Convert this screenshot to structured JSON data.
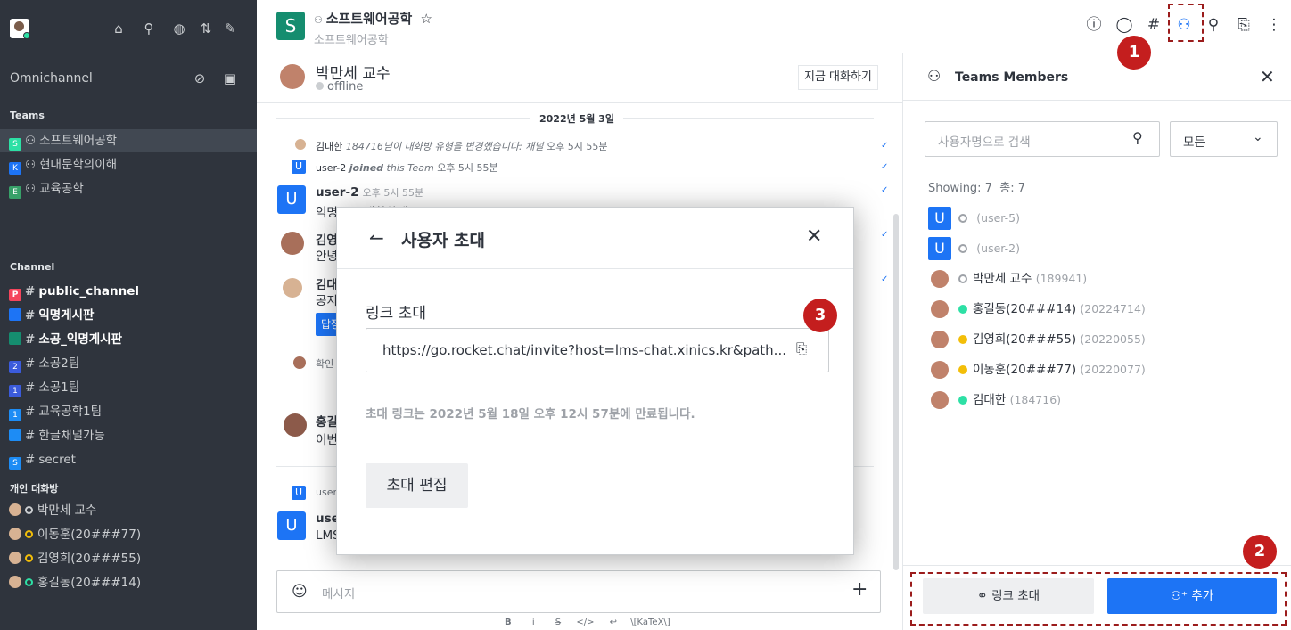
{
  "sidebar": {
    "workspace_label": "Omnichannel",
    "teams_heading": "Teams",
    "teams": [
      {
        "badge": "S",
        "color": "#2de0a5",
        "label": "소프트웨어공학",
        "selected": true
      },
      {
        "badge": "K",
        "color": "#1d74f5",
        "label": "현대문학의이해",
        "selected": false
      },
      {
        "badge": "E",
        "color": "#38a169",
        "label": "교육공학",
        "selected": false
      }
    ],
    "channel_heading": "Channel",
    "channels": [
      {
        "badge": "P",
        "color": "#f5455c",
        "label": "public_channel",
        "bold": true
      },
      {
        "badge": "",
        "color": "#1d74f5",
        "label": "익명게시판",
        "bold": true
      },
      {
        "badge": "",
        "color": "#158d6f",
        "label": "소공_익명게시판",
        "bold": true
      },
      {
        "badge": "2",
        "color": "#3b5bdb",
        "label": "소공2팀",
        "bold": false
      },
      {
        "badge": "1",
        "color": "#3b5bdb",
        "label": "소공1팀",
        "bold": false
      },
      {
        "badge": "1",
        "color": "#1d8cf5",
        "label": "교육공학1팀",
        "bold": false
      },
      {
        "badge": "",
        "color": "#1d8cf5",
        "label": "한글채널가능",
        "bold": false
      },
      {
        "badge": "S",
        "color": "#1d8cf5",
        "label": "secret",
        "bold": false
      }
    ],
    "dm_heading": "개인 대화방",
    "dms": [
      {
        "label": "박만세 교수",
        "status": "offline",
        "status_color": "#cbced1"
      },
      {
        "label": "이동훈(20###77)",
        "status": "away",
        "status_color": "#f3be08"
      },
      {
        "label": "김영희(20###55)",
        "status": "away",
        "status_color": "#f3be08"
      },
      {
        "label": "홍길동(20###14)",
        "status": "online",
        "status_color": "#2de0a5"
      }
    ]
  },
  "header": {
    "avatar_letter": "S",
    "title": "소프트웨어공학",
    "subtitle": "소프트웨어공학"
  },
  "chat": {
    "dm_name": "박만세 교수",
    "dm_status": "offline",
    "talk_now_button": "지금 대화하기",
    "date_divider": "2022년 5월 3일",
    "sys1_name": "김대한",
    "sys1_text": "184716님이 대화방 유형을 변경했습니다: 채널",
    "sys1_time": "오후 5시 55분",
    "sys2_name": "user-2",
    "sys2_joined": "joined",
    "sys2_text": "this Team",
    "sys2_time": "오후 5시 55분",
    "m1_name": "user-2",
    "m1_time": "오후 5시 55분",
    "m1_text": "익명으로 대화하세요",
    "m2_name": "김영희",
    "m2_text": "안녕",
    "m3_name": "김대한",
    "m3_text": "공지",
    "m3_btn": "답장",
    "m4_text": "확인",
    "m5_name": "홍길동",
    "m5_text": "이번",
    "m6_text": "user",
    "m7_name": "user",
    "m7_text": "LMS",
    "composer_placeholder": "메시지",
    "toolbar_katex": "\\[KaTeX\\]",
    "toolbar_b": "B",
    "toolbar_i": "i"
  },
  "modal": {
    "title": "사용자 초대",
    "link_label": "링크 초대",
    "link_value": "https://go.rocket.chat/invite?host=lms-chat.xinics.kr&path...",
    "expiry_text": "초대 링크는 2022년 5월 18일 오후 12시 57분에 만료됩니다.",
    "edit_button": "초대 편집"
  },
  "panel": {
    "title": "Teams Members",
    "search_placeholder": "사용자명으로 검색",
    "filter_value": "모든",
    "showing_text": "Showing: 7  총: 7",
    "members": [
      {
        "avatar": "U",
        "name": "",
        "id": "(user-5)",
        "status_color": "#ffffff",
        "status": "offline"
      },
      {
        "avatar": "U",
        "name": "",
        "id": "(user-2)",
        "status_color": "#ffffff",
        "status": "offline"
      },
      {
        "avatar": "face",
        "name": "박만세 교수",
        "id": "(189941)",
        "status_color": "#ffffff",
        "status": "offline"
      },
      {
        "avatar": "face",
        "name": "홍길동(20###14)",
        "id": "(20224714)",
        "status_color": "#2de0a5",
        "status": "online"
      },
      {
        "avatar": "face",
        "name": "김영희(20###55)",
        "id": "(20220055)",
        "status_color": "#f3be08",
        "status": "away"
      },
      {
        "avatar": "face",
        "name": "이동훈(20###77)",
        "id": "(20220077)",
        "status_color": "#f3be08",
        "status": "away"
      },
      {
        "avatar": "face",
        "name": "김대한",
        "id": "(184716)",
        "status_color": "#2de0a5",
        "status": "online"
      }
    ],
    "link_invite_button": "링크 초대",
    "add_button": "추가"
  },
  "markers": {
    "m1": "1",
    "m2": "2",
    "m3": "3"
  },
  "colors": {
    "accent": "#1d74f5",
    "sidebar_bg": "#2f343d",
    "marker": "#c41e1e"
  }
}
